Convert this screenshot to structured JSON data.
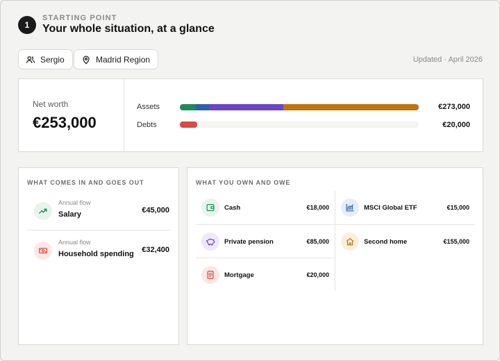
{
  "header": {
    "step_number": "1",
    "eyebrow": "STARTING POINT",
    "title": "Your whole situation, at a glance"
  },
  "chips": {
    "user": {
      "label": "Sergio",
      "icon": "users-icon"
    },
    "region": {
      "label": "Madrid Region",
      "icon": "map-pin-icon"
    }
  },
  "updated": "Updated · April 2026",
  "net_worth": {
    "label": "Net worth",
    "value": "€253,000",
    "assets": {
      "label": "Assets",
      "amount": "€273,000",
      "segments": [
        {
          "name": "Cash",
          "value": 18000,
          "color": "#1e8a5a"
        },
        {
          "name": "MSCI Global ETF",
          "value": 15000,
          "color": "#2e5fa8"
        },
        {
          "name": "Private pension",
          "value": 85000,
          "color": "#6a44c9"
        },
        {
          "name": "Second home",
          "value": 155000,
          "color": "#c0730f"
        }
      ]
    },
    "debts": {
      "label": "Debts",
      "amount": "€20,000",
      "fraction_of_assets": 0.073,
      "color": "#d84a44"
    }
  },
  "flows": {
    "title": "WHAT COMES IN AND GOES OUT",
    "items": [
      {
        "kicker": "Annual flow",
        "name": "Salary",
        "amount": "€45,000",
        "icon": "trending-up-icon",
        "color": "#1e8a5a",
        "bg": "#e6f4ec"
      },
      {
        "kicker": "Annual flow",
        "name": "Household spending",
        "amount": "€32,400",
        "icon": "banknote-icon",
        "color": "#d84a44",
        "bg": "#fbe7e5"
      }
    ]
  },
  "holdings": {
    "title": "WHAT YOU OWN AND OWE",
    "items": [
      {
        "name": "Cash",
        "amount": "€18,000",
        "icon": "wallet-icon",
        "color": "#1e8a5a",
        "bg": "#e6f4ec"
      },
      {
        "name": "MSCI Global ETF",
        "amount": "€15,000",
        "icon": "chart-line-icon",
        "color": "#2e5fa8",
        "bg": "#e5edf8"
      },
      {
        "name": "Private pension",
        "amount": "€85,000",
        "icon": "piggy-bank-icon",
        "color": "#6a44c9",
        "bg": "#eee8fa"
      },
      {
        "name": "Second home",
        "amount": "€155,000",
        "icon": "house-icon",
        "color": "#c0730f",
        "bg": "#fbefdc"
      },
      {
        "name": "Mortgage",
        "amount": "€20,000",
        "icon": "document-icon",
        "color": "#d84a44",
        "bg": "#fbe7e5"
      }
    ]
  }
}
